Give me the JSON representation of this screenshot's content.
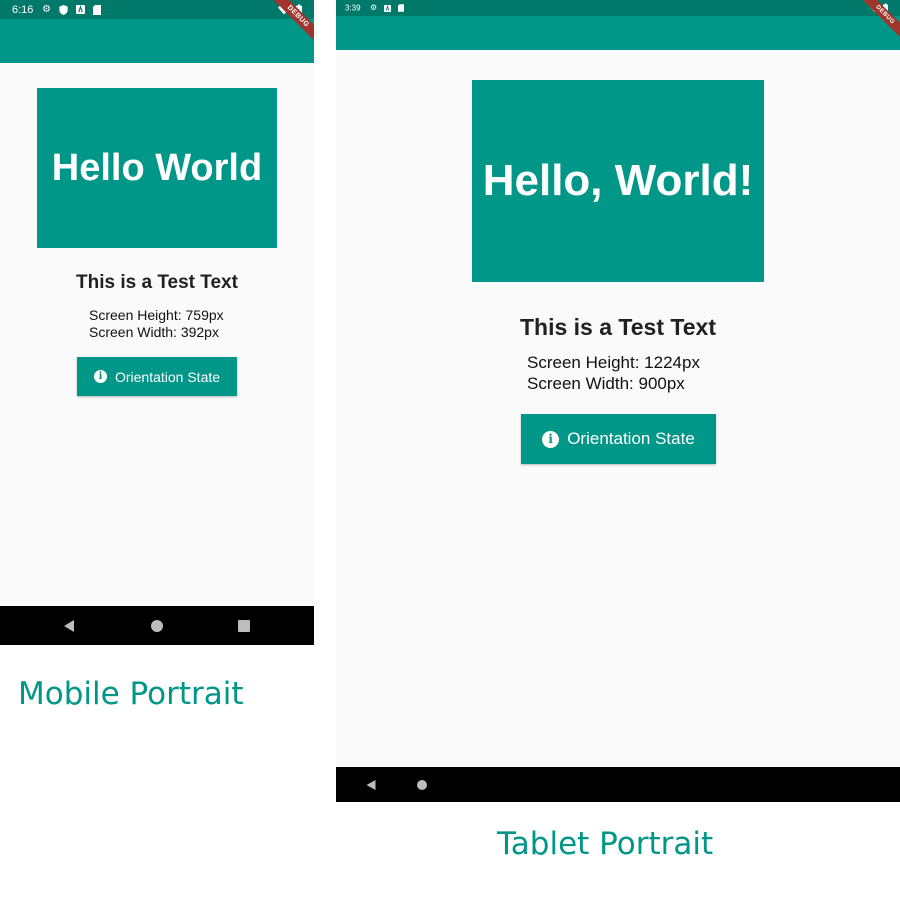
{
  "mobile": {
    "status_time": "6:16",
    "debug_label": "DEBUG",
    "hello_text": "Hello World",
    "test_text": "This is a Test Text",
    "screen_height_text": "Screen Height: 759px",
    "screen_width_text": "Screen Width: 392px",
    "button_label": "Orientation State",
    "caption": "Mobile Portrait"
  },
  "tablet": {
    "status_time": "3:39",
    "debug_label": "DEBUG",
    "hello_text": "Hello, World!",
    "test_text": "This is a Test Text",
    "screen_height_text": "Screen Height: 1224px",
    "screen_width_text": "Screen Width: 900px",
    "button_label": "Orientation State",
    "caption": "Tablet Portrait"
  },
  "icons": {
    "status_left": [
      "settings-icon",
      "shield-icon",
      "text-icon",
      "sd-card-icon"
    ],
    "status_right": [
      "wifi-icon",
      "battery-icon"
    ],
    "button": "info-icon",
    "nav": [
      "back-icon",
      "home-icon",
      "recents-icon"
    ]
  },
  "colors": {
    "primary": "#009688",
    "status_bar": "#00796b",
    "background": "#fafafa",
    "nav_bar": "#000000",
    "debug_banner": "#a1352c"
  }
}
